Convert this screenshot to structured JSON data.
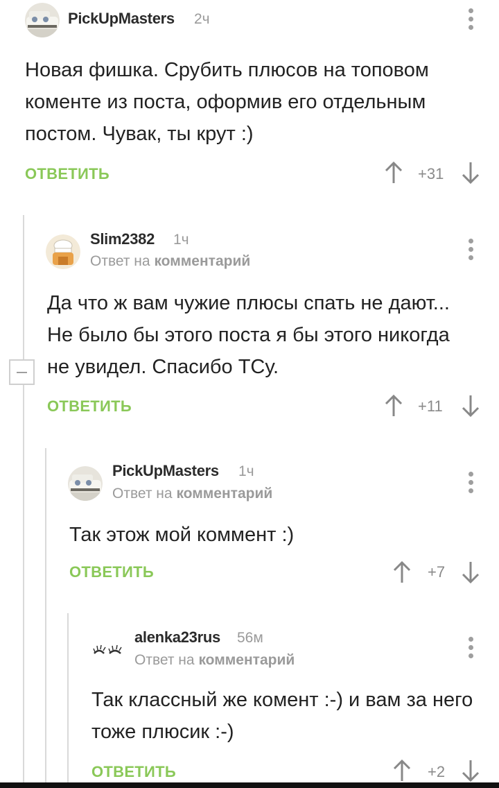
{
  "comments": [
    {
      "username": "PickUpMasters",
      "time": "2ч",
      "reply_prefix": "",
      "reply_target": "",
      "text": "Новая фишка. Срубить плюсов на топовом коменте из поста, оформив его отдельным постом. Чувак, ты крут :)",
      "reply_label": "ОТВЕТИТЬ",
      "score": "+31",
      "avatar": "car-avatar"
    },
    {
      "username": "Slim2382",
      "time": "1ч",
      "reply_prefix": "Ответ на",
      "reply_target": "комментарий",
      "text": "Да что ж вам чужие плюсы спать не дают... Не было бы этого поста я бы этого никогда не увидел. Спасибо ТСу.",
      "reply_label": "ОТВЕТИТЬ",
      "score": "+11",
      "avatar": "chef-avatar"
    },
    {
      "username": "PickUpMasters",
      "time": "1ч",
      "reply_prefix": "Ответ на",
      "reply_target": "комментарий",
      "text": "Так этож мой коммент :)",
      "reply_label": "ОТВЕТИТЬ",
      "score": "+7",
      "avatar": "car-avatar"
    },
    {
      "username": "alenka23rus",
      "time": "56м",
      "reply_prefix": "Ответ на",
      "reply_target": "комментарий",
      "text": "Так классный же комент :-) и вам за него тоже плюсик :-)",
      "reply_label": "ОТВЕТИТЬ",
      "score": "+2",
      "avatar": "eyelashes-avatar"
    }
  ],
  "colors": {
    "reply_green": "#8ac858",
    "text": "#222222",
    "muted": "#9a9a9a",
    "thread_line": "#d9d9d9"
  }
}
